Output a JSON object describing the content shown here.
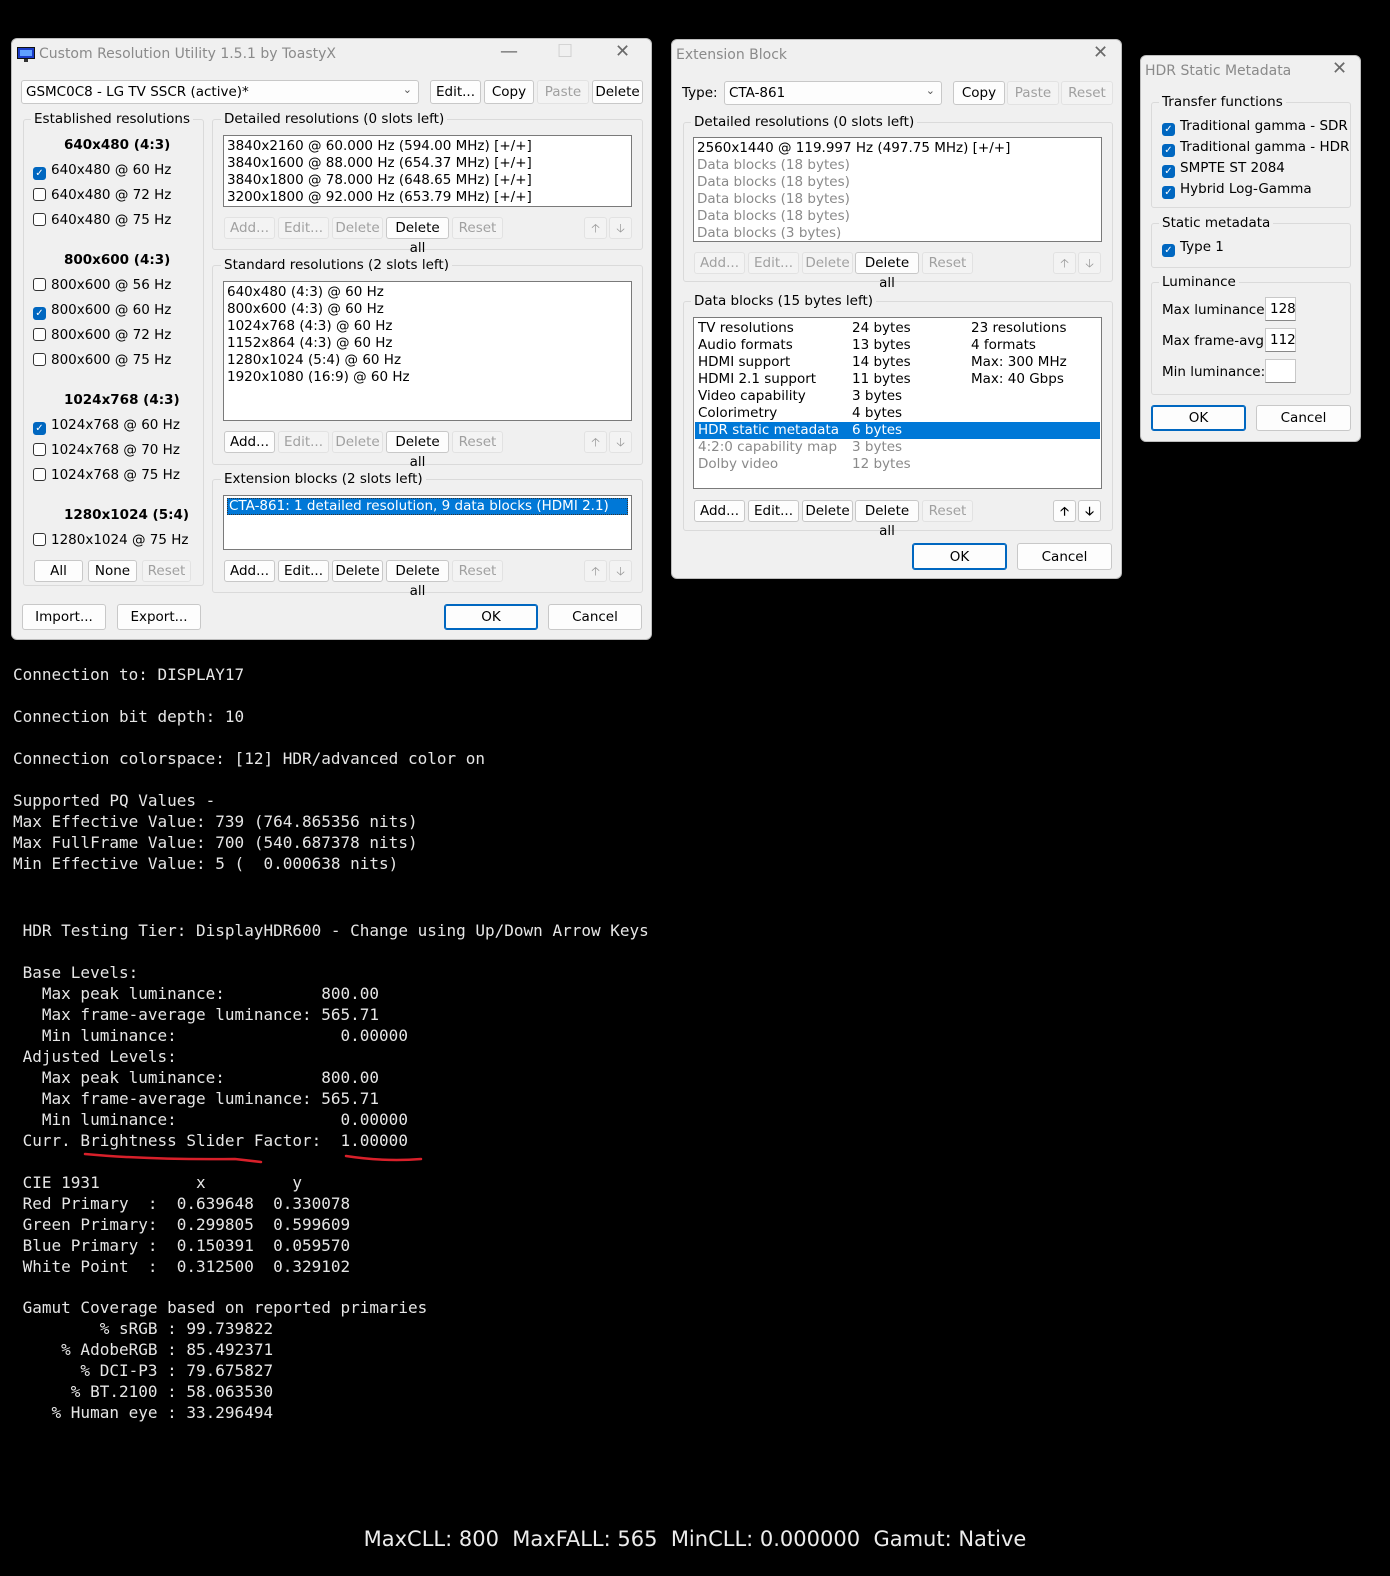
{
  "cru": {
    "title": "Custom Resolution Utility 1.5.1 by ToastyX",
    "display_select": "GSMC0C8 - LG TV SSCR (active)*",
    "top_buttons": [
      "Edit...",
      "Copy",
      "Paste",
      "Delete"
    ],
    "established": {
      "label": "Established resolutions",
      "groups": [
        {
          "heading": "640x480 (4:3)",
          "items": [
            {
              "label": "640x480 @ 60 Hz",
              "checked": true
            },
            {
              "label": "640x480 @ 72 Hz",
              "checked": false
            },
            {
              "label": "640x480 @ 75 Hz",
              "checked": false
            }
          ]
        },
        {
          "heading": "800x600 (4:3)",
          "items": [
            {
              "label": "800x600 @ 56 Hz",
              "checked": false
            },
            {
              "label": "800x600 @ 60 Hz",
              "checked": true
            },
            {
              "label": "800x600 @ 72 Hz",
              "checked": false
            },
            {
              "label": "800x600 @ 75 Hz",
              "checked": false
            }
          ]
        },
        {
          "heading": "1024x768 (4:3)",
          "items": [
            {
              "label": "1024x768 @ 60 Hz",
              "checked": true
            },
            {
              "label": "1024x768 @ 70 Hz",
              "checked": false
            },
            {
              "label": "1024x768 @ 75 Hz",
              "checked": false
            }
          ]
        },
        {
          "heading": "1280x1024 (5:4)",
          "items": [
            {
              "label": "1280x1024 @ 75 Hz",
              "checked": false
            }
          ]
        }
      ],
      "buttons": [
        "All",
        "None",
        "Reset"
      ]
    },
    "detailed": {
      "label": "Detailed resolutions (0 slots left)",
      "rows": [
        "3840x2160 @ 60.000 Hz (594.00 MHz) [+/+]",
        "3840x1600 @ 88.000 Hz (654.37 MHz) [+/+]",
        "3840x1800 @ 78.000 Hz (648.65 MHz) [+/+]",
        "3200x1800 @ 92.000 Hz (653.79 MHz) [+/+]"
      ]
    },
    "standard": {
      "label": "Standard resolutions (2 slots left)",
      "rows": [
        "640x480 (4:3) @ 60 Hz",
        "800x600 (4:3) @ 60 Hz",
        "1024x768 (4:3) @ 60 Hz",
        "1152x864 (4:3) @ 60 Hz",
        "1280x1024 (5:4) @ 60 Hz",
        "1920x1080 (16:9) @ 60 Hz"
      ]
    },
    "extension": {
      "label": "Extension blocks (2 slots left)",
      "rows": [
        "CTA-861: 1 detailed resolution, 9 data blocks (HDMI 2.1)"
      ]
    },
    "list_buttons": {
      "add": "Add...",
      "edit": "Edit...",
      "delete": "Delete",
      "delete_all": "Delete all",
      "reset": "Reset",
      "up": "🡡",
      "down": "🡣"
    },
    "import": "Import...",
    "export": "Export...",
    "ok": "OK",
    "cancel": "Cancel"
  },
  "ext": {
    "title": "Extension Block",
    "type_label": "Type:",
    "type_value": "CTA-861",
    "top_buttons": [
      "Copy",
      "Paste",
      "Reset"
    ],
    "detailed": {
      "label": "Detailed resolutions (0 slots left)",
      "rows": [
        "2560x1440 @ 119.997 Hz (497.75 MHz) [+/+]",
        "Data blocks (18 bytes)",
        "Data blocks (18 bytes)",
        "Data blocks (18 bytes)",
        "Data blocks (18 bytes)",
        "Data blocks (3 bytes)"
      ]
    },
    "data_blocks": {
      "label": "Data blocks (15 bytes left)",
      "rows": [
        {
          "name": "TV resolutions",
          "size": "24 bytes",
          "info": "23 resolutions"
        },
        {
          "name": "Audio formats",
          "size": "13 bytes",
          "info": "4 formats"
        },
        {
          "name": "HDMI support",
          "size": "14 bytes",
          "info": "Max: 300 MHz"
        },
        {
          "name": "HDMI 2.1 support",
          "size": "11 bytes",
          "info": "Max: 40 Gbps"
        },
        {
          "name": "Video capability",
          "size": "3 bytes",
          "info": ""
        },
        {
          "name": "Colorimetry",
          "size": "4 bytes",
          "info": ""
        },
        {
          "name": "HDR static metadata",
          "size": "6 bytes",
          "info": ""
        },
        {
          "name": "4:2:0 capability map",
          "size": "3 bytes",
          "info": ""
        },
        {
          "name": "Dolby video",
          "size": "12 bytes",
          "info": ""
        }
      ]
    },
    "ok": "OK",
    "cancel": "Cancel"
  },
  "hdr": {
    "title": "HDR Static Metadata",
    "transfer_label": "Transfer functions",
    "transfer": [
      {
        "label": "Traditional gamma - SDR",
        "checked": true
      },
      {
        "label": "Traditional gamma - HDR",
        "checked": true
      },
      {
        "label": "SMPTE ST 2084",
        "checked": true
      },
      {
        "label": "Hybrid Log-Gamma",
        "checked": true
      }
    ],
    "static_label": "Static metadata",
    "static_type": {
      "label": "Type 1",
      "checked": true
    },
    "luminance_label": "Luminance",
    "max_lum_label": "Max luminance:",
    "max_lum": "128",
    "max_frame_label": "Max frame-avg:",
    "max_frame": "112",
    "min_lum_label": "Min luminance:",
    "min_lum": "",
    "ok": "OK",
    "cancel": "Cancel"
  },
  "terminal": {
    "line1": "Connection to: DISPLAY17",
    "line2": "Connection bit depth: 10",
    "line3": "Connection colorspace: [12] HDR/advanced color on",
    "pq_block": "Supported PQ Values -\nMax Effective Value: 739 (764.865356 nits)\nMax FullFrame Value: 700 (540.687378 nits)\nMin Effective Value: 5 (  0.000638 nits)",
    "tier": " HDR Testing Tier: DisplayHDR600 - Change using Up/Down Arrow Keys",
    "levels_block": " Base Levels:\n   Max peak luminance:          800.00\n   Max frame-average luminance: 565.71\n   Min luminance:                 0.00000\n Adjusted Levels:\n   Max peak luminance:          800.00\n   Max frame-average luminance: 565.71\n   Min luminance:                 0.00000\n Curr. Brightness Slider Factor:  1.00000",
    "cie_block": " CIE 1931          x         y\n Red Primary  :  0.639648  0.330078\n Green Primary:  0.299805  0.599609\n Blue Primary :  0.150391  0.059570\n White Point  :  0.312500  0.329102",
    "gamut_block": " Gamut Coverage based on reported primaries\n         % sRGB : 99.739822\n     % AdobeRGB : 85.492371\n       % DCI-P3 : 79.675827\n      % BT.2100 : 58.063530\n    % Human eye : 33.296494"
  },
  "status_bar": "MaxCLL: 800  MaxFALL: 565  MinCLL: 0.000000  Gamut: Native",
  "colors": {
    "selection": "#0078d7",
    "underline_marker": "#d8202a",
    "default_button": "#0067c0"
  }
}
